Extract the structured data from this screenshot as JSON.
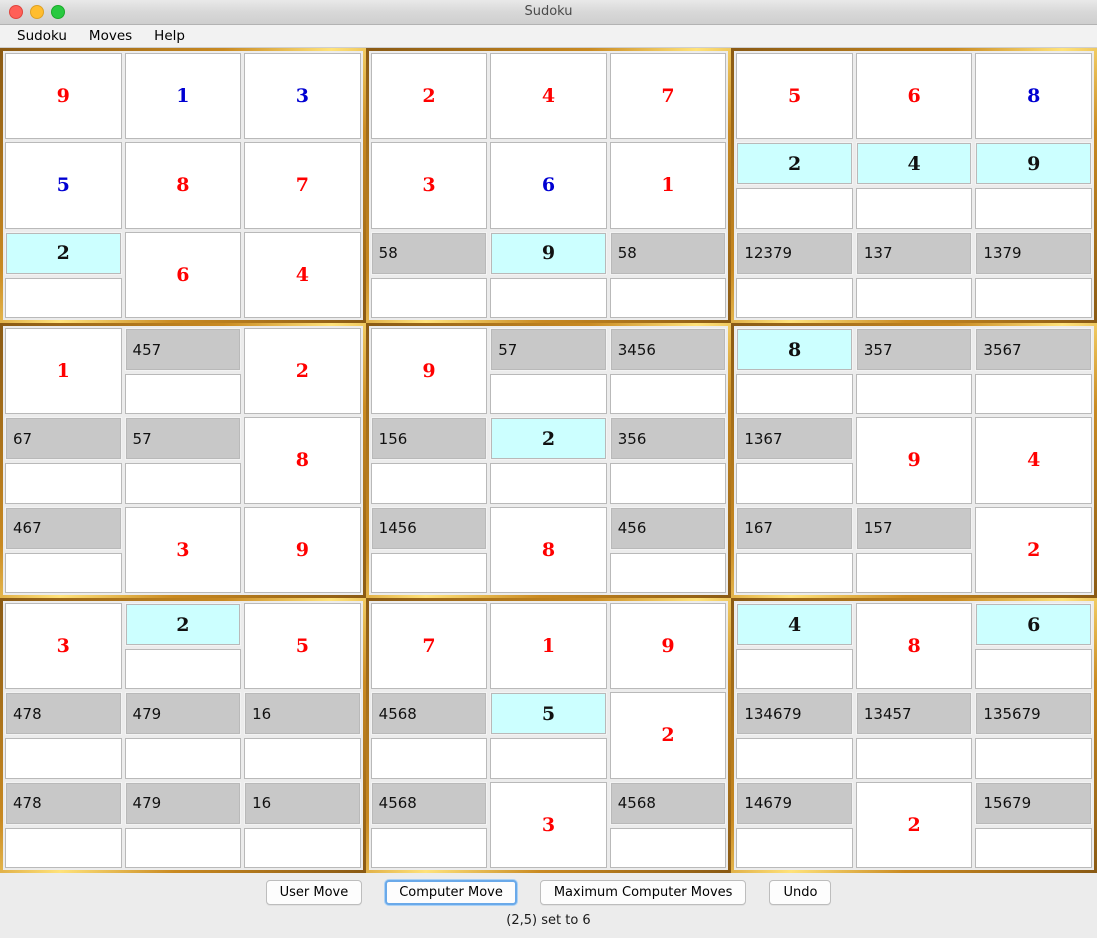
{
  "window": {
    "title": "Sudoku",
    "controls": {
      "close": "close",
      "minimize": "minimize",
      "maximize": "maximize"
    }
  },
  "menubar": {
    "items": [
      {
        "label": "Sudoku"
      },
      {
        "label": "Moves"
      },
      {
        "label": "Help"
      }
    ]
  },
  "colors": {
    "value_given": "#ff0000",
    "value_user": "#0000d2",
    "highlight_bg": "#ccffff",
    "candidate_bg": "#c8c8c8",
    "block_border": "#8a5a14",
    "block_border_light": "#ffe27a",
    "focus_ring": "#6aa9e9"
  },
  "board": {
    "blocks": [
      {
        "cells": [
          {
            "type": "solved",
            "value": "9",
            "color": "red"
          },
          {
            "type": "solved",
            "value": "1",
            "color": "blue"
          },
          {
            "type": "solved",
            "value": "3",
            "color": "blue"
          },
          {
            "type": "solved",
            "value": "5",
            "color": "blue"
          },
          {
            "type": "solved",
            "value": "8",
            "color": "red"
          },
          {
            "type": "solved",
            "value": "7",
            "color": "red"
          },
          {
            "type": "open",
            "bar": "highlight",
            "text": "2"
          },
          {
            "type": "solved",
            "value": "6",
            "color": "red"
          },
          {
            "type": "solved",
            "value": "4",
            "color": "red"
          }
        ]
      },
      {
        "cells": [
          {
            "type": "solved",
            "value": "2",
            "color": "red"
          },
          {
            "type": "solved",
            "value": "4",
            "color": "red"
          },
          {
            "type": "solved",
            "value": "7",
            "color": "red"
          },
          {
            "type": "solved",
            "value": "3",
            "color": "red"
          },
          {
            "type": "solved",
            "value": "6",
            "color": "blue"
          },
          {
            "type": "solved",
            "value": "1",
            "color": "red"
          },
          {
            "type": "open",
            "bar": "candidates",
            "text": "58"
          },
          {
            "type": "open",
            "bar": "highlight",
            "text": "9"
          },
          {
            "type": "open",
            "bar": "candidates",
            "text": "58"
          }
        ]
      },
      {
        "cells": [
          {
            "type": "solved",
            "value": "5",
            "color": "red"
          },
          {
            "type": "solved",
            "value": "6",
            "color": "red"
          },
          {
            "type": "solved",
            "value": "8",
            "color": "blue"
          },
          {
            "type": "open",
            "bar": "highlight",
            "text": "2"
          },
          {
            "type": "open",
            "bar": "highlight",
            "text": "4"
          },
          {
            "type": "open",
            "bar": "highlight",
            "text": "9"
          },
          {
            "type": "open",
            "bar": "candidates",
            "text": "12379"
          },
          {
            "type": "open",
            "bar": "candidates",
            "text": "137"
          },
          {
            "type": "open",
            "bar": "candidates",
            "text": "1379"
          }
        ]
      },
      {
        "cells": [
          {
            "type": "solved",
            "value": "1",
            "color": "red"
          },
          {
            "type": "open",
            "bar": "candidates",
            "text": "457"
          },
          {
            "type": "solved",
            "value": "2",
            "color": "red"
          },
          {
            "type": "open",
            "bar": "candidates",
            "text": "67"
          },
          {
            "type": "open",
            "bar": "candidates",
            "text": "57"
          },
          {
            "type": "solved",
            "value": "8",
            "color": "red"
          },
          {
            "type": "open",
            "bar": "candidates",
            "text": "467"
          },
          {
            "type": "solved",
            "value": "3",
            "color": "red"
          },
          {
            "type": "solved",
            "value": "9",
            "color": "red"
          }
        ]
      },
      {
        "cells": [
          {
            "type": "solved",
            "value": "9",
            "color": "red"
          },
          {
            "type": "open",
            "bar": "candidates",
            "text": "57"
          },
          {
            "type": "open",
            "bar": "candidates",
            "text": "3456"
          },
          {
            "type": "open",
            "bar": "candidates",
            "text": "156"
          },
          {
            "type": "open",
            "bar": "highlight",
            "text": "2"
          },
          {
            "type": "open",
            "bar": "candidates",
            "text": "356"
          },
          {
            "type": "open",
            "bar": "candidates",
            "text": "1456"
          },
          {
            "type": "solved",
            "value": "8",
            "color": "red"
          },
          {
            "type": "open",
            "bar": "candidates",
            "text": "456"
          }
        ]
      },
      {
        "cells": [
          {
            "type": "open",
            "bar": "highlight",
            "text": "8"
          },
          {
            "type": "open",
            "bar": "candidates",
            "text": "357"
          },
          {
            "type": "open",
            "bar": "candidates",
            "text": "3567"
          },
          {
            "type": "open",
            "bar": "candidates",
            "text": "1367"
          },
          {
            "type": "solved",
            "value": "9",
            "color": "red"
          },
          {
            "type": "solved",
            "value": "4",
            "color": "red"
          },
          {
            "type": "open",
            "bar": "candidates",
            "text": "167"
          },
          {
            "type": "open",
            "bar": "candidates",
            "text": "157"
          },
          {
            "type": "solved",
            "value": "2",
            "color": "red"
          }
        ]
      },
      {
        "cells": [
          {
            "type": "solved",
            "value": "3",
            "color": "red"
          },
          {
            "type": "open",
            "bar": "highlight",
            "text": "2"
          },
          {
            "type": "solved",
            "value": "5",
            "color": "red"
          },
          {
            "type": "open",
            "bar": "candidates",
            "text": "478"
          },
          {
            "type": "open",
            "bar": "candidates",
            "text": "479"
          },
          {
            "type": "open",
            "bar": "candidates",
            "text": "16"
          },
          {
            "type": "open",
            "bar": "candidates",
            "text": "478"
          },
          {
            "type": "open",
            "bar": "candidates",
            "text": "479"
          },
          {
            "type": "open",
            "bar": "candidates",
            "text": "16"
          }
        ]
      },
      {
        "cells": [
          {
            "type": "solved",
            "value": "7",
            "color": "red"
          },
          {
            "type": "solved",
            "value": "1",
            "color": "red"
          },
          {
            "type": "solved",
            "value": "9",
            "color": "red"
          },
          {
            "type": "open",
            "bar": "candidates",
            "text": "4568"
          },
          {
            "type": "open",
            "bar": "highlight",
            "text": "5"
          },
          {
            "type": "solved",
            "value": "2",
            "color": "red"
          },
          {
            "type": "open",
            "bar": "candidates",
            "text": "4568"
          },
          {
            "type": "solved",
            "value": "3",
            "color": "red"
          },
          {
            "type": "open",
            "bar": "candidates",
            "text": "4568"
          }
        ]
      },
      {
        "cells": [
          {
            "type": "open",
            "bar": "highlight",
            "text": "4"
          },
          {
            "type": "solved",
            "value": "8",
            "color": "red"
          },
          {
            "type": "open",
            "bar": "highlight",
            "text": "6"
          },
          {
            "type": "open",
            "bar": "candidates",
            "text": "134679"
          },
          {
            "type": "open",
            "bar": "candidates",
            "text": "13457"
          },
          {
            "type": "open",
            "bar": "candidates",
            "text": "135679"
          },
          {
            "type": "open",
            "bar": "candidates",
            "text": "14679"
          },
          {
            "type": "solved",
            "value": "2",
            "color": "red"
          },
          {
            "type": "open",
            "bar": "candidates",
            "text": "15679"
          }
        ]
      }
    ]
  },
  "controls": {
    "buttons": [
      {
        "label": "User Move",
        "focused": false
      },
      {
        "label": "Computer Move",
        "focused": true
      },
      {
        "label": "Maximum Computer Moves",
        "focused": false
      },
      {
        "label": "Undo",
        "focused": false
      }
    ],
    "status": "(2,5) set to 6"
  }
}
